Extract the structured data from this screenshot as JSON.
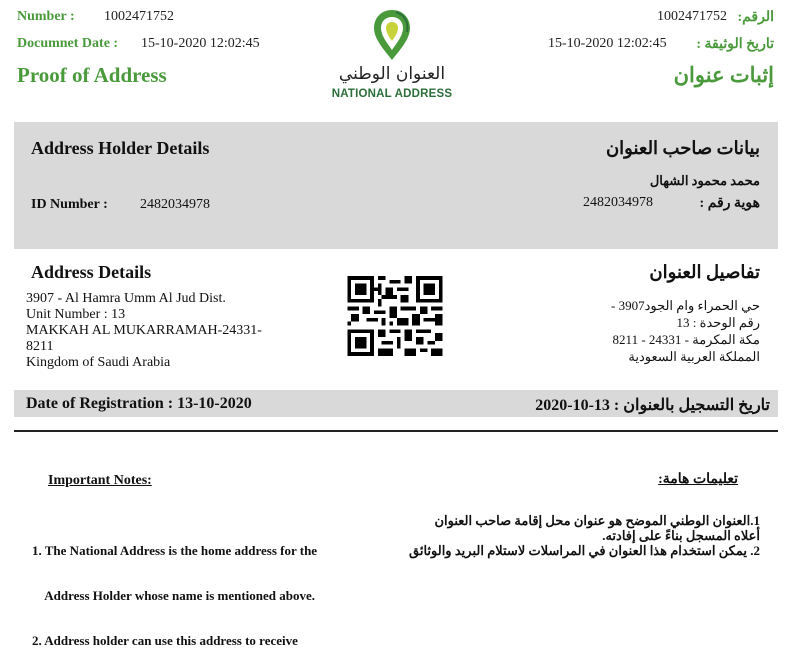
{
  "header": {
    "number_label_en": "Number :",
    "number_value_en": "1002471752",
    "date_label_en": "Documnet Date :",
    "date_value_en": "15-10-2020 12:02:45",
    "number_label_ar": "الرقم:",
    "number_value_ar": "1002471752",
    "date_label_ar": "تاريخ الوثيقة :",
    "date_value_ar": "15-10-2020 12:02:45",
    "title_en": "Proof of Address",
    "title_ar": "إثبات عنوان"
  },
  "logo": {
    "icon": "location-pin-icon",
    "name_ar": "العنوان الوطني",
    "name_en": "NATIONAL ADDRESS",
    "brand_green": "#4a9a3c",
    "brand_dark": "#2d6f3a",
    "brand_yellow": "#c8d23a"
  },
  "holder": {
    "title_en": "Address Holder Details",
    "title_ar": "بيانات صاحب العنوان",
    "name_ar": "محمد محمود  الشهال",
    "id_label_en": "ID Number :",
    "id_value_en": "2482034978",
    "id_label_ar": "هوية رقم :",
    "id_value_ar": "2482034978"
  },
  "address": {
    "title_en": "Address Details",
    "title_ar": "تفاصيل العنوان",
    "lines_en": [
      "3907 -  Al Hamra Umm Al Jud Dist.",
      "Unit Number : 13",
      "MAKKAH AL MUKARRAMAH-24331-",
      "8211",
      "Kingdom of Saudi Arabia"
    ],
    "lines_ar": [
      "حي الحمراء وام الجود3907 -",
      "رقم الوحدة :  13",
      "مكة المكرمة  -  24331  -  8211",
      "المملكة العربية السعودية"
    ],
    "qr_icon": "qr-code-icon"
  },
  "registration": {
    "label_en": "Date of Registration : 13-10-2020",
    "label_ar": "تاريخ التسجيل بالعنوان : 13-10-2020"
  },
  "notes": {
    "heading_en": "Important Notes:",
    "heading_ar": "تعليمات هامة:",
    "items_en": [
      "1. The National Address is the home address for the",
      "    Address Holder whose name is mentioned above.",
      "2. Address holder can use this address to receive"
    ],
    "items_ar": [
      "1.العنوان الوطني الموضح هو عنوان محل إقامة صاحب العنوان",
      "أعلاه المسجل بناءً على إفادته.",
      "2. يمكن استخدام هذا العنوان في المراسلات لاستلام البريد والوثائق"
    ]
  }
}
